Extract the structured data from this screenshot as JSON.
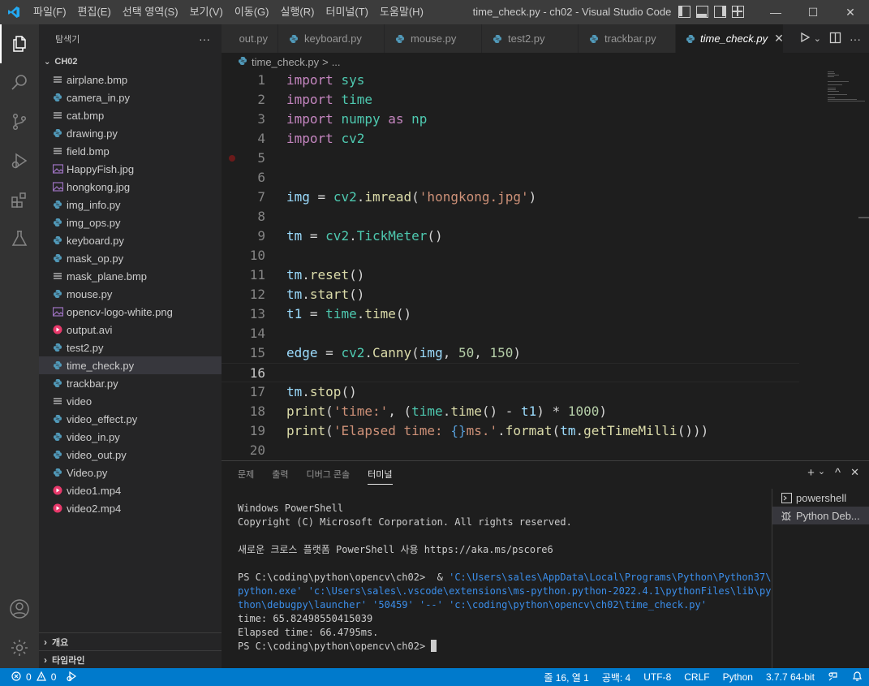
{
  "window": {
    "title": "time_check.py - ch02 - Visual Studio Code",
    "menu": [
      "파일(F)",
      "편집(E)",
      "선택 영역(S)",
      "보기(V)",
      "이동(G)",
      "실행(R)",
      "터미널(T)",
      "도움말(H)"
    ],
    "minimize": "—",
    "maximize": "☐",
    "close": "✕"
  },
  "sidebar": {
    "title": "탐색기",
    "more": "···",
    "folder": "CH02",
    "files": [
      {
        "name": "airplane.bmp",
        "icon": "lines-icon"
      },
      {
        "name": "camera_in.py",
        "icon": "python-icon"
      },
      {
        "name": "cat.bmp",
        "icon": "lines-icon"
      },
      {
        "name": "drawing.py",
        "icon": "python-icon"
      },
      {
        "name": "field.bmp",
        "icon": "lines-icon"
      },
      {
        "name": "HappyFish.jpg",
        "icon": "image-icon"
      },
      {
        "name": "hongkong.jpg",
        "icon": "image-icon"
      },
      {
        "name": "img_info.py",
        "icon": "python-icon"
      },
      {
        "name": "img_ops.py",
        "icon": "python-icon"
      },
      {
        "name": "keyboard.py",
        "icon": "python-icon"
      },
      {
        "name": "mask_op.py",
        "icon": "python-icon"
      },
      {
        "name": "mask_plane.bmp",
        "icon": "lines-icon"
      },
      {
        "name": "mouse.py",
        "icon": "python-icon"
      },
      {
        "name": "opencv-logo-white.png",
        "icon": "image-icon"
      },
      {
        "name": "output.avi",
        "icon": "video-icon"
      },
      {
        "name": "test2.py",
        "icon": "python-icon"
      },
      {
        "name": "time_check.py",
        "icon": "python-icon"
      },
      {
        "name": "trackbar.py",
        "icon": "python-icon"
      },
      {
        "name": "video",
        "icon": "lines-icon"
      },
      {
        "name": "video_effect.py",
        "icon": "python-icon"
      },
      {
        "name": "video_in.py",
        "icon": "python-icon"
      },
      {
        "name": "video_out.py",
        "icon": "python-icon"
      },
      {
        "name": "Video.py",
        "icon": "python-icon"
      },
      {
        "name": "video1.mp4",
        "icon": "video-icon"
      },
      {
        "name": "video2.mp4",
        "icon": "video-icon"
      }
    ],
    "selected_index": 16,
    "outline_label": "개요",
    "timeline_label": "타임라인"
  },
  "tabs": [
    {
      "label": "out.py"
    },
    {
      "label": "keyboard.py"
    },
    {
      "label": "mouse.py"
    },
    {
      "label": "test2.py"
    },
    {
      "label": "trackbar.py"
    },
    {
      "label": "time_check.py",
      "active": true
    }
  ],
  "breadcrumb": {
    "file": "time_check.py",
    "sep": ">",
    "rest": "..."
  },
  "editor": {
    "current_line": 16,
    "breakpoint_line": 5,
    "lines": [
      [
        [
          "kw",
          "import"
        ],
        [
          "op",
          " "
        ],
        [
          "mod",
          "sys"
        ]
      ],
      [
        [
          "kw",
          "import"
        ],
        [
          "op",
          " "
        ],
        [
          "mod",
          "time"
        ]
      ],
      [
        [
          "kw",
          "import"
        ],
        [
          "op",
          " "
        ],
        [
          "mod",
          "numpy"
        ],
        [
          "op",
          " "
        ],
        [
          "kw",
          "as"
        ],
        [
          "op",
          " "
        ],
        [
          "mod",
          "np"
        ]
      ],
      [
        [
          "kw",
          "import"
        ],
        [
          "op",
          " "
        ],
        [
          "mod",
          "cv2"
        ]
      ],
      [],
      [],
      [
        [
          "var",
          "img"
        ],
        [
          "op",
          " = "
        ],
        [
          "mod",
          "cv2"
        ],
        [
          "op",
          "."
        ],
        [
          "fn",
          "imread"
        ],
        [
          "op",
          "("
        ],
        [
          "str",
          "'hongkong.jpg'"
        ],
        [
          "op",
          ")"
        ]
      ],
      [],
      [
        [
          "var",
          "tm"
        ],
        [
          "op",
          " = "
        ],
        [
          "mod",
          "cv2"
        ],
        [
          "op",
          "."
        ],
        [
          "mod",
          "TickMeter"
        ],
        [
          "op",
          "()"
        ]
      ],
      [],
      [
        [
          "var",
          "tm"
        ],
        [
          "op",
          "."
        ],
        [
          "fn",
          "reset"
        ],
        [
          "op",
          "()"
        ]
      ],
      [
        [
          "var",
          "tm"
        ],
        [
          "op",
          "."
        ],
        [
          "fn",
          "start"
        ],
        [
          "op",
          "()"
        ]
      ],
      [
        [
          "var",
          "t1"
        ],
        [
          "op",
          " = "
        ],
        [
          "mod",
          "time"
        ],
        [
          "op",
          "."
        ],
        [
          "fn",
          "time"
        ],
        [
          "op",
          "()"
        ]
      ],
      [],
      [
        [
          "var",
          "edge"
        ],
        [
          "op",
          " = "
        ],
        [
          "mod",
          "cv2"
        ],
        [
          "op",
          "."
        ],
        [
          "fn",
          "Canny"
        ],
        [
          "op",
          "("
        ],
        [
          "var",
          "img"
        ],
        [
          "op",
          ", "
        ],
        [
          "num",
          "50"
        ],
        [
          "op",
          ", "
        ],
        [
          "num",
          "150"
        ],
        [
          "op",
          ")"
        ]
      ],
      [],
      [
        [
          "var",
          "tm"
        ],
        [
          "op",
          "."
        ],
        [
          "fn",
          "stop"
        ],
        [
          "op",
          "()"
        ]
      ],
      [
        [
          "fn",
          "print"
        ],
        [
          "op",
          "("
        ],
        [
          "str",
          "'time:'"
        ],
        [
          "op",
          ", ("
        ],
        [
          "mod",
          "time"
        ],
        [
          "op",
          "."
        ],
        [
          "fn",
          "time"
        ],
        [
          "op",
          "() - "
        ],
        [
          "var",
          "t1"
        ],
        [
          "op",
          ") * "
        ],
        [
          "num",
          "1000"
        ],
        [
          "op",
          ")"
        ]
      ],
      [
        [
          "fn",
          "print"
        ],
        [
          "op",
          "("
        ],
        [
          "str",
          "'Elapsed time: "
        ],
        [
          "brace",
          "{}"
        ],
        [
          "str",
          "ms.'"
        ],
        [
          "op",
          "."
        ],
        [
          "fn",
          "format"
        ],
        [
          "op",
          "("
        ],
        [
          "var",
          "tm"
        ],
        [
          "op",
          "."
        ],
        [
          "fn",
          "getTimeMilli"
        ],
        [
          "op",
          "()))"
        ]
      ],
      []
    ]
  },
  "panel": {
    "tabs": [
      "문제",
      "출력",
      "디버그 콘솔",
      "터미널"
    ],
    "active_tab": 3,
    "add": "+",
    "dropdown": "⌄",
    "maximize": "^",
    "close": "✕",
    "terminal_lines": [
      {
        "text": "Windows PowerShell",
        "style": "plain"
      },
      {
        "text": "Copyright (C) Microsoft Corporation. All rights reserved.",
        "style": "plain"
      },
      {
        "text": "",
        "style": "plain"
      },
      {
        "text": "새로운 크로스 플랫폼 PowerShell 사용 https://aka.ms/pscore6",
        "style": "plain"
      },
      {
        "text": "",
        "style": "plain"
      },
      {
        "parts": [
          [
            "plain",
            "PS C:\\coding\\python\\opencv\\ch02>  & "
          ],
          [
            "blue",
            "'C:\\Users\\sales\\AppData\\Local\\Programs\\Python\\Python37\\"
          ]
        ]
      },
      {
        "text": "python.exe' 'c:\\Users\\sales\\.vscode\\extensions\\ms-python.python-2022.4.1\\pythonFiles\\lib\\py",
        "style": "blue"
      },
      {
        "text": "thon\\debugpy\\launcher' '50459' '--' 'c:\\coding\\python\\opencv\\ch02\\time_check.py'",
        "style": "blue"
      },
      {
        "text": "time: 65.82498550415039",
        "style": "plain"
      },
      {
        "text": "Elapsed time: 66.4795ms.",
        "style": "plain"
      },
      {
        "text": "PS C:\\coding\\python\\opencv\\ch02> ",
        "style": "plain",
        "cursor": true
      }
    ],
    "terminals": [
      {
        "name": "powershell",
        "icon": "terminal-icon"
      },
      {
        "name": "Python Deb...",
        "icon": "debug-icon",
        "selected": true
      }
    ]
  },
  "statusbar": {
    "errors": "0",
    "warnings": "0",
    "position": "줄 16, 열 1",
    "spaces": "공백: 4",
    "encoding": "UTF-8",
    "eol": "CRLF",
    "language": "Python",
    "interpreter": "3.7.7 64-bit"
  },
  "colors": {
    "accent": "#007acc",
    "python_icon": "#519aba",
    "image_icon": "#a074c4",
    "video_icon": "#e8396b"
  }
}
